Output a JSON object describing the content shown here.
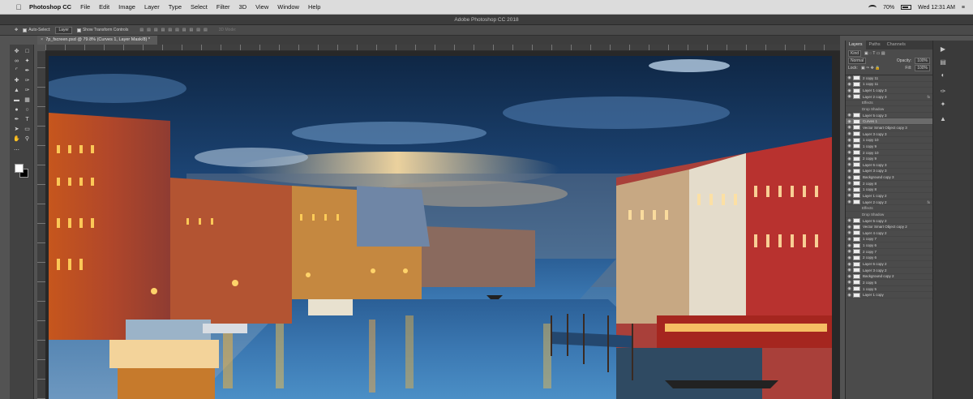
{
  "menubar": {
    "apple_icon": "apple-icon",
    "items": [
      "Photoshop CC",
      "File",
      "Edit",
      "Image",
      "Layer",
      "Type",
      "Select",
      "Filter",
      "3D",
      "View",
      "Window",
      "Help"
    ],
    "battery": "70%",
    "clock": "Wed 12:31 AM"
  },
  "window": {
    "title": "Adobe Photoshop CC 2018"
  },
  "options": {
    "auto_select_label": "Auto-Select:",
    "auto_select_value": "Layer",
    "transform_label": "Show Transform Controls",
    "mode_3d": "3D Mode:"
  },
  "document": {
    "tab_label": "7p_fscreen.psd @ 79.8% (Curves 1, Layer Mask/8) *"
  },
  "panel": {
    "tabs": [
      "Layers",
      "Paths",
      "Channels"
    ],
    "kind_label": "Kind",
    "blend_mode": "Normal",
    "opacity_label": "Opacity:",
    "opacity_value": "100%",
    "lock_label": "Lock:",
    "fill_label": "Fill:",
    "fill_value": "100%"
  },
  "layers": [
    {
      "name": "2 copy 11"
    },
    {
      "name": "1 copy 11"
    },
    {
      "name": "Layer 1 copy 3"
    },
    {
      "name": "Layer 2 copy 3",
      "fx": "fx"
    },
    {
      "name": "Effects",
      "sub": true
    },
    {
      "name": "Drop Shadow",
      "sub": true
    },
    {
      "name": "Layer 5 copy 3"
    },
    {
      "name": "Curves 1",
      "selected": true
    },
    {
      "name": "Vector Smart Object copy 3"
    },
    {
      "name": "Layer 3 copy 3"
    },
    {
      "name": "1 copy 10"
    },
    {
      "name": "1 copy 9"
    },
    {
      "name": "2 copy 10"
    },
    {
      "name": "2 copy 9"
    },
    {
      "name": "Layer 6 copy 3"
    },
    {
      "name": "Layer 3 copy 3"
    },
    {
      "name": "Background copy 3"
    },
    {
      "name": "2 copy 8"
    },
    {
      "name": "1 copy 8"
    },
    {
      "name": "Layer 1 copy 2"
    },
    {
      "name": "Layer 2 copy 2",
      "fx": "fx"
    },
    {
      "name": "Effects",
      "sub": true
    },
    {
      "name": "Drop Shadow",
      "sub": true
    },
    {
      "name": "Layer 5 copy 2"
    },
    {
      "name": "Vector Smart Object copy 2"
    },
    {
      "name": "Layer 4 copy 2"
    },
    {
      "name": "1 copy 7"
    },
    {
      "name": "1 copy 6"
    },
    {
      "name": "2 copy 7"
    },
    {
      "name": "2 copy 6"
    },
    {
      "name": "Layer 6 copy 2"
    },
    {
      "name": "Layer 3 copy 2"
    },
    {
      "name": "Background copy 2"
    },
    {
      "name": "2 copy 5"
    },
    {
      "name": "1 copy 5"
    },
    {
      "name": "Layer 1 copy"
    }
  ]
}
